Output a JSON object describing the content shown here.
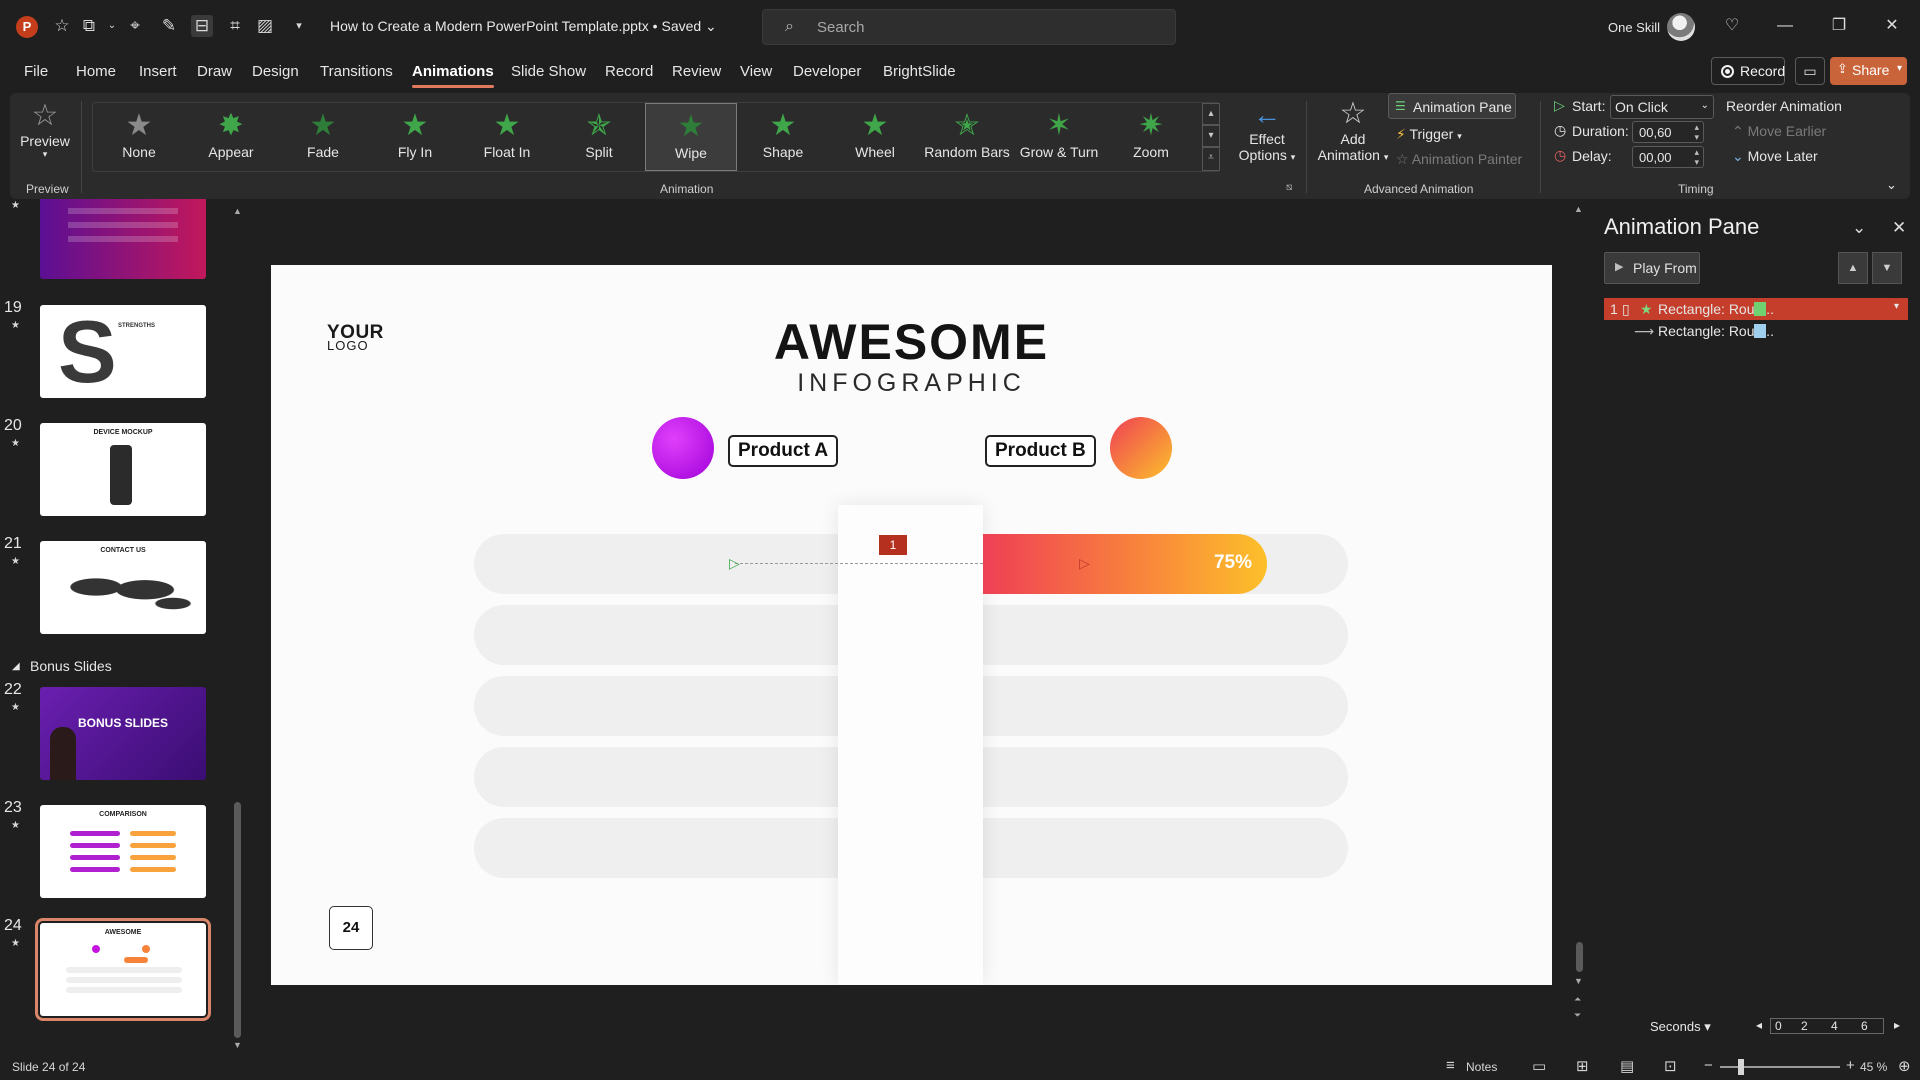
{
  "titlebar": {
    "app_icon": "P",
    "doc_title": "How to Create a Modern PowerPoint Template.pptx • Saved ⌄",
    "search_placeholder": "Search",
    "user_name": "One Skill"
  },
  "menu": {
    "tabs": [
      "File",
      "Home",
      "Insert",
      "Draw",
      "Design",
      "Transitions",
      "Animations",
      "Slide Show",
      "Record",
      "Review",
      "View",
      "Developer",
      "BrightSlide"
    ],
    "active_tab": "Animations",
    "record_label": "Record",
    "share_label": "Share"
  },
  "ribbon": {
    "preview_label": "Preview",
    "preview_group": "Preview",
    "animations": [
      "None",
      "Appear",
      "Fade",
      "Fly In",
      "Float In",
      "Split",
      "Wipe",
      "Shape",
      "Wheel",
      "Random Bars",
      "Grow & Turn",
      "Zoom"
    ],
    "selected_animation": "Wipe",
    "effect_options_line1": "Effect",
    "effect_options_line2": "Options",
    "animation_group": "Animation",
    "add_animation_line1": "Add",
    "add_animation_line2": "Animation",
    "animation_pane_label": "Animation Pane",
    "trigger_label": "Trigger",
    "animation_painter_label": "Animation Painter",
    "advanced_group": "Advanced Animation",
    "start_label": "Start:",
    "start_value": "On Click",
    "duration_label": "Duration:",
    "duration_value": "00,60",
    "delay_label": "Delay:",
    "delay_value": "00,00",
    "timing_group": "Timing",
    "reorder_label": "Reorder Animation",
    "move_earlier": "Move Earlier",
    "move_later": "Move Later"
  },
  "thumbnails": {
    "section_label": "Bonus Slides",
    "slides": [
      {
        "num": "19",
        "title": "STRENGTHS"
      },
      {
        "num": "20",
        "title": "DEVICE MOCKUP"
      },
      {
        "num": "21",
        "title": "CONTACT US"
      },
      {
        "num": "22",
        "title": "BONUS SLIDES"
      },
      {
        "num": "23",
        "title": "COMPARISON"
      },
      {
        "num": "24",
        "title": "AWESOME"
      }
    ]
  },
  "slide": {
    "logo_line1": "YOUR",
    "logo_line2": "LOGO",
    "title": "AWESOME",
    "subtitle": "INFOGRAPHIC",
    "product_a": "Product A",
    "product_b": "Product B",
    "bar_value_label": "75%",
    "bar_value_fraction": 0.75,
    "animation_tag": "1",
    "page_number": "24",
    "colors": {
      "product_a": "#c614e0",
      "product_b_start": "#ef3f55",
      "product_b_end": "#fcc02a"
    }
  },
  "animation_pane": {
    "title": "Animation Pane",
    "play_from": "Play From",
    "items": [
      {
        "index": "1",
        "name": "Rectangle: Roun...",
        "swatch": "#6fd16f"
      },
      {
        "index": "",
        "name": "Rectangle: Roun...",
        "swatch": "#9fd0ee"
      }
    ],
    "timeline_unit": "Seconds",
    "timeline_ticks": [
      "0",
      "2",
      "4",
      "6"
    ]
  },
  "statusbar": {
    "slide_info": "Slide 24 of 24",
    "notes_label": "Notes",
    "zoom_label": "45 %"
  }
}
